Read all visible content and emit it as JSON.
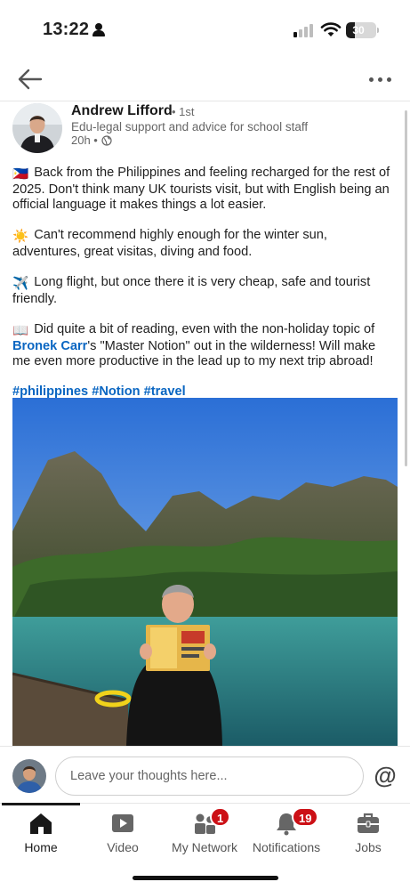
{
  "status_bar": {
    "time": "13:22",
    "battery": "30",
    "battery_level": 0.3
  },
  "post": {
    "author": {
      "name": "Andrew Lifford",
      "degree": "• 1st",
      "headline": "Edu-legal support and advice for school staff",
      "time": "20h •",
      "visibility_icon": "globe-icon"
    },
    "paragraphs": {
      "p1": {
        "emoji": "🇵🇭",
        "text": " Back from the Philippines and feeling recharged for the rest of 2025. Don't think many UK tourists visit, but with English being an official language it makes things a lot easier."
      },
      "p2": {
        "emoji": "☀️",
        "text": " Can't recommend highly enough for the winter sun, adventures, great visitas, diving and food."
      },
      "p3": {
        "emoji": "✈️",
        "text": " Long flight, but once there it is very cheap, safe and tourist friendly."
      },
      "p4": {
        "emoji": "📖",
        "before": " Did quite a bit of reading, even with the non-holiday topic of ",
        "mention": "Bronek Carr",
        "after": "'s \"Master Notion\" out in the wilderness! Will make me even more productive in the lead up to my next trip abroad!"
      }
    },
    "hashtags": {
      "h1": "#philippines",
      "h2": "#Notion",
      "h3": "#travel"
    }
  },
  "comment": {
    "placeholder": "Leave your thoughts here...",
    "mention_symbol": "@"
  },
  "tabs": [
    {
      "label": "Home",
      "icon": "home-icon",
      "active": true
    },
    {
      "label": "Video",
      "icon": "video-icon"
    },
    {
      "label": "My Network",
      "icon": "network-icon",
      "badge": "1"
    },
    {
      "label": "Notifications",
      "icon": "bell-icon",
      "badge": "19"
    },
    {
      "label": "Jobs",
      "icon": "briefcase-icon"
    }
  ],
  "colors": {
    "accent": "#0a66c2",
    "badge": "#cc1016"
  }
}
